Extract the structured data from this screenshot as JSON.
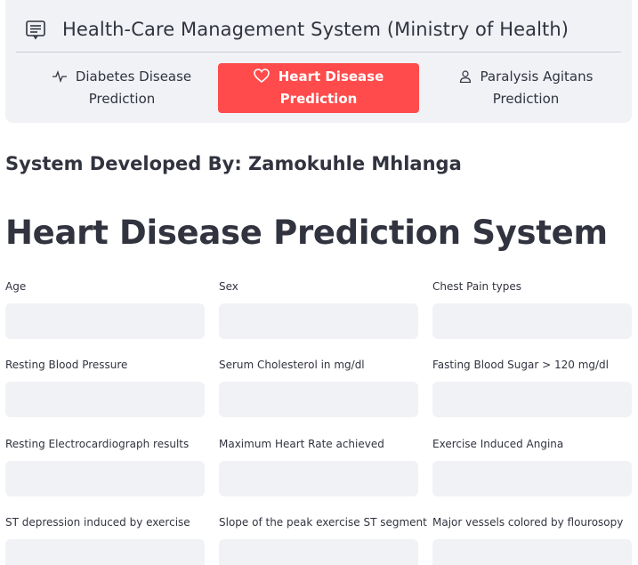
{
  "menu": {
    "title": "Health-Care Management System (Ministry of Health)",
    "title_icon": "list-card-icon",
    "items": [
      {
        "label": "Diabetes Disease Prediction",
        "icon": "activity-icon",
        "active": false
      },
      {
        "label": "Heart Disease Prediction",
        "icon": "heart-icon",
        "active": true
      },
      {
        "label": "Paralysis Agitans Prediction",
        "icon": "person-icon",
        "active": false
      }
    ],
    "active_color": "#ff4b4b",
    "background_color": "#f0f2f6"
  },
  "developer_credit": "System Developed By: Zamokuhle Mhlanga",
  "page_title": "Heart Disease Prediction System",
  "fields": [
    {
      "label": "Age",
      "value": ""
    },
    {
      "label": "Sex",
      "value": ""
    },
    {
      "label": "Chest Pain types",
      "value": ""
    },
    {
      "label": "Resting Blood Pressure",
      "value": ""
    },
    {
      "label": "Serum Cholesterol in mg/dl",
      "value": ""
    },
    {
      "label": "Fasting Blood Sugar > 120 mg/dl",
      "value": ""
    },
    {
      "label": "Resting Electrocardiograph results",
      "value": ""
    },
    {
      "label": "Maximum Heart Rate achieved",
      "value": ""
    },
    {
      "label": "Exercise Induced Angina",
      "value": ""
    },
    {
      "label": "ST depression induced by exercise",
      "value": ""
    },
    {
      "label": "Slope of the peak exercise ST segment",
      "value": ""
    },
    {
      "label": "Major vessels colored by flourosopy",
      "value": ""
    }
  ]
}
